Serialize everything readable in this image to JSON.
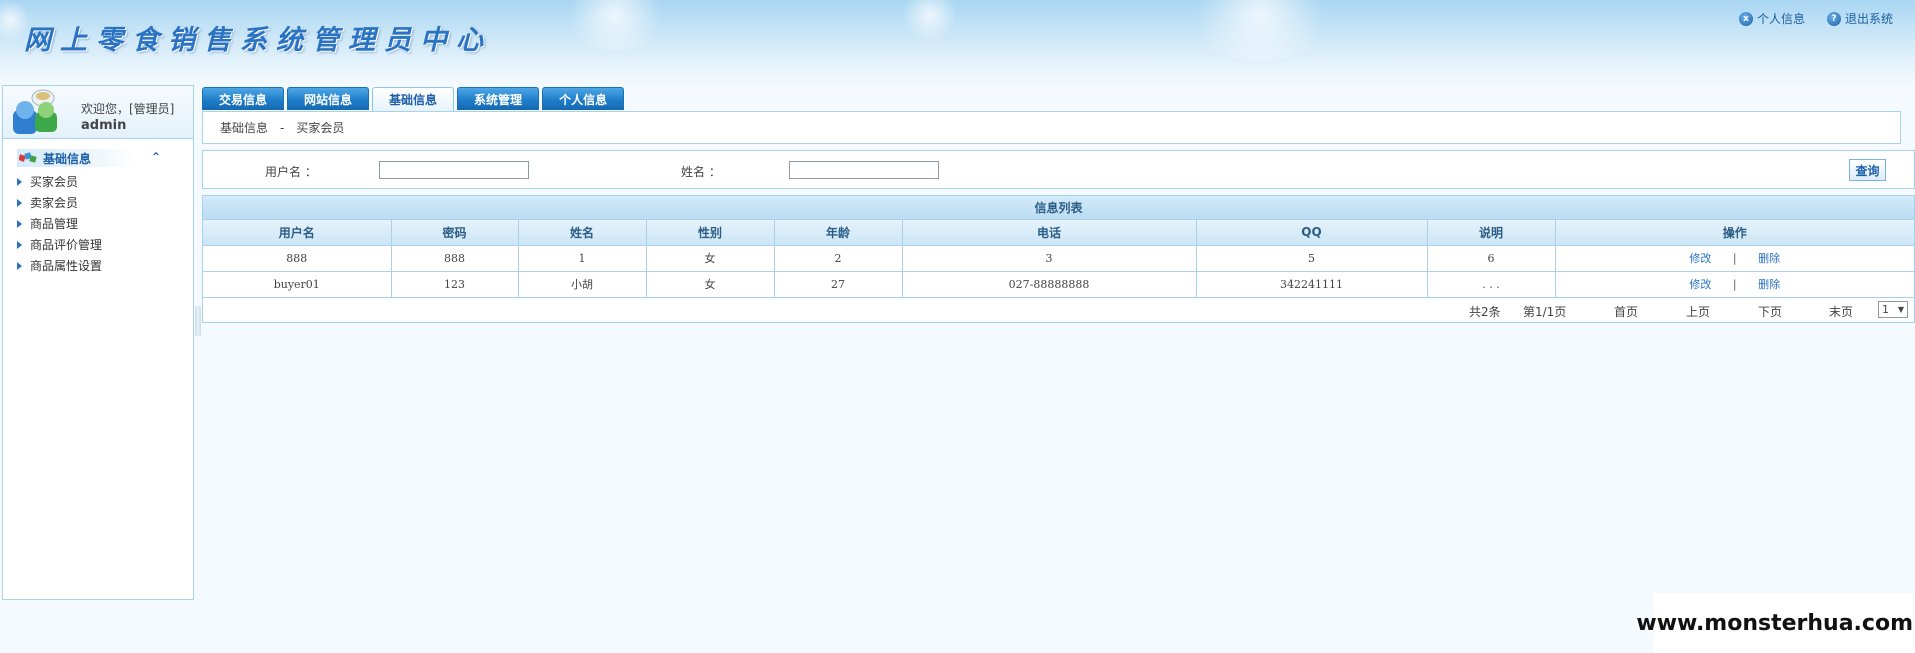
{
  "header": {
    "app_title": "网上零食销售系统管理员中心",
    "links": [
      {
        "label": "个人信息",
        "icon": "x-circle-icon"
      },
      {
        "label": "退出系统",
        "icon": "question-icon"
      }
    ]
  },
  "sidebar": {
    "welcome": "欢迎您，[管理员]",
    "username": "admin",
    "section_title": "基础信息",
    "items": [
      {
        "label": "买家会员"
      },
      {
        "label": "卖家会员"
      },
      {
        "label": "商品管理"
      },
      {
        "label": "商品评价管理"
      },
      {
        "label": "商品属性设置"
      }
    ]
  },
  "tabs": [
    {
      "label": "交易信息",
      "active": false
    },
    {
      "label": "网站信息",
      "active": false
    },
    {
      "label": "基础信息",
      "active": true
    },
    {
      "label": "系统管理",
      "active": false
    },
    {
      "label": "个人信息",
      "active": false
    }
  ],
  "breadcrumb": {
    "section": "基础信息",
    "sep": "-",
    "page": "买家会员"
  },
  "search": {
    "username_label": "用户名  ：",
    "username_value": "",
    "name_label": "姓名  ：",
    "name_value": "",
    "query_button": "查询"
  },
  "table": {
    "caption": "信息列表",
    "columns": [
      "用户名",
      "密码",
      "姓名",
      "性别",
      "年龄",
      "电话",
      "QQ",
      "说明",
      "操作"
    ],
    "rows": [
      {
        "cells": [
          "888",
          "888",
          "1",
          "女",
          "2",
          "3",
          "5",
          "6"
        ],
        "edit": "修改",
        "sep": "|",
        "delete": "删除"
      },
      {
        "cells": [
          "buyer01",
          "123",
          "小胡",
          "女",
          "27",
          "027-88888888",
          "342241111",
          ". . ."
        ],
        "edit": "修改",
        "sep": "|",
        "delete": "删除"
      }
    ]
  },
  "pager": {
    "total": "共2条",
    "page_info": "第1/1页",
    "first": "首页",
    "prev": "上页",
    "next": "下页",
    "last": "末页",
    "page_select": "1",
    "dropdown_arrow": "▼"
  },
  "watermark": "www.monsterhua.com",
  "colors": {
    "accent": "#2a73c2",
    "tab": "#1f7ec9",
    "border": "#a8d2ea",
    "header_bg": "#a9d6f2"
  }
}
